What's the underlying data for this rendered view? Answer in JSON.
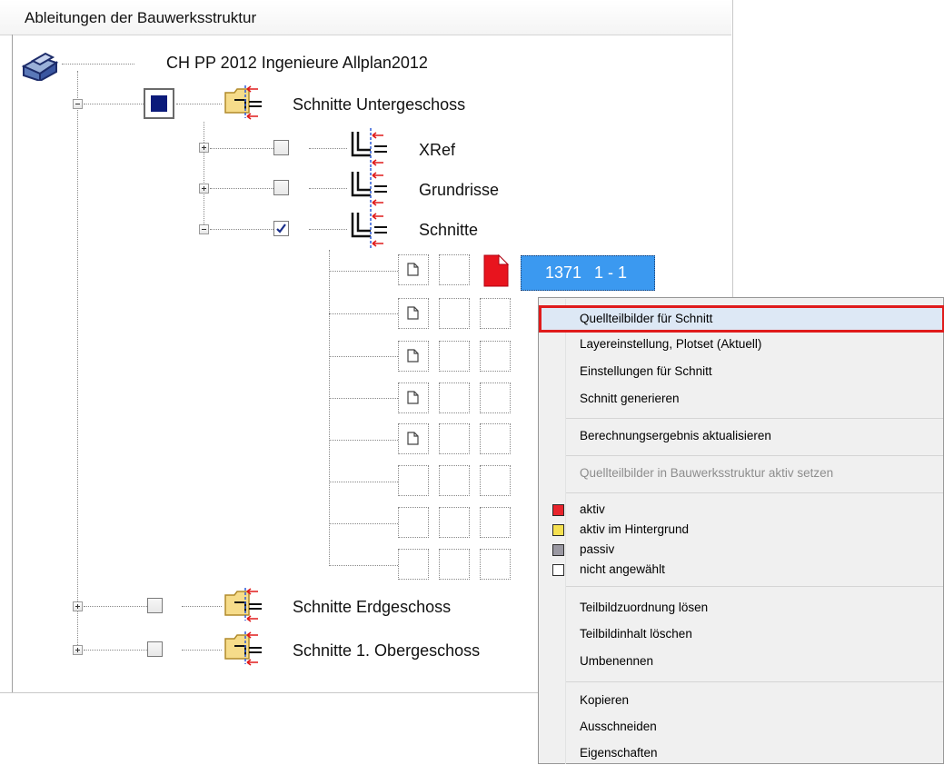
{
  "panel": {
    "title": "Ableitungen der Bauwerksstruktur"
  },
  "tree": {
    "root": {
      "label": "CH PP 2012 Ingenieure Allplan2012",
      "icon": "building-model-icon"
    },
    "groups": [
      {
        "label": "Schnitte Untergeschoss",
        "icon": "folder-section-icon",
        "expanded": true
      },
      {
        "label": "Schnitte Erdgeschoss",
        "icon": "folder-section-icon",
        "expanded": false
      },
      {
        "label": "Schnitte 1. Obergeschoss",
        "icon": "folder-section-icon",
        "expanded": false
      }
    ],
    "subgroups": [
      {
        "label": "XRef",
        "checked": false
      },
      {
        "label": "Grundrisse",
        "checked": false
      },
      {
        "label": "Schnitte",
        "checked": true
      }
    ],
    "selected_item": {
      "number": "1371",
      "name": "1 - 1",
      "status_color": "#e8141e"
    }
  },
  "context_menu": {
    "items": [
      {
        "label": "Quellteilbilder für Schnitt",
        "highlighted": true
      },
      {
        "label": "Layereinstellung, Plotset (Aktuell)"
      },
      {
        "label": "Einstellungen für Schnitt"
      },
      {
        "label": "Schnitt generieren"
      },
      {
        "label": "Berechnungsergebnis aktualisieren"
      },
      {
        "label": "Quellteilbilder in Bauwerksstruktur aktiv setzen",
        "disabled": true
      },
      {
        "label": "aktiv",
        "swatch": "#e8242c"
      },
      {
        "label": "aktiv im Hintergrund",
        "swatch": "#f5e050"
      },
      {
        "label": "passiv",
        "swatch": "#9a98a2"
      },
      {
        "label": "nicht angewählt",
        "swatch": "#ffffff"
      },
      {
        "label": "Teilbildzuordnung lösen"
      },
      {
        "label": "Teilbildinhalt löschen"
      },
      {
        "label": "Umbenennen"
      },
      {
        "label": "Kopieren"
      },
      {
        "label": "Ausschneiden"
      },
      {
        "label": "Eigenschaften"
      }
    ]
  },
  "colors": {
    "selection": "#3b99f0",
    "highlight_border": "#e01b1b",
    "checkbox_fill": "#0b1a7a"
  }
}
